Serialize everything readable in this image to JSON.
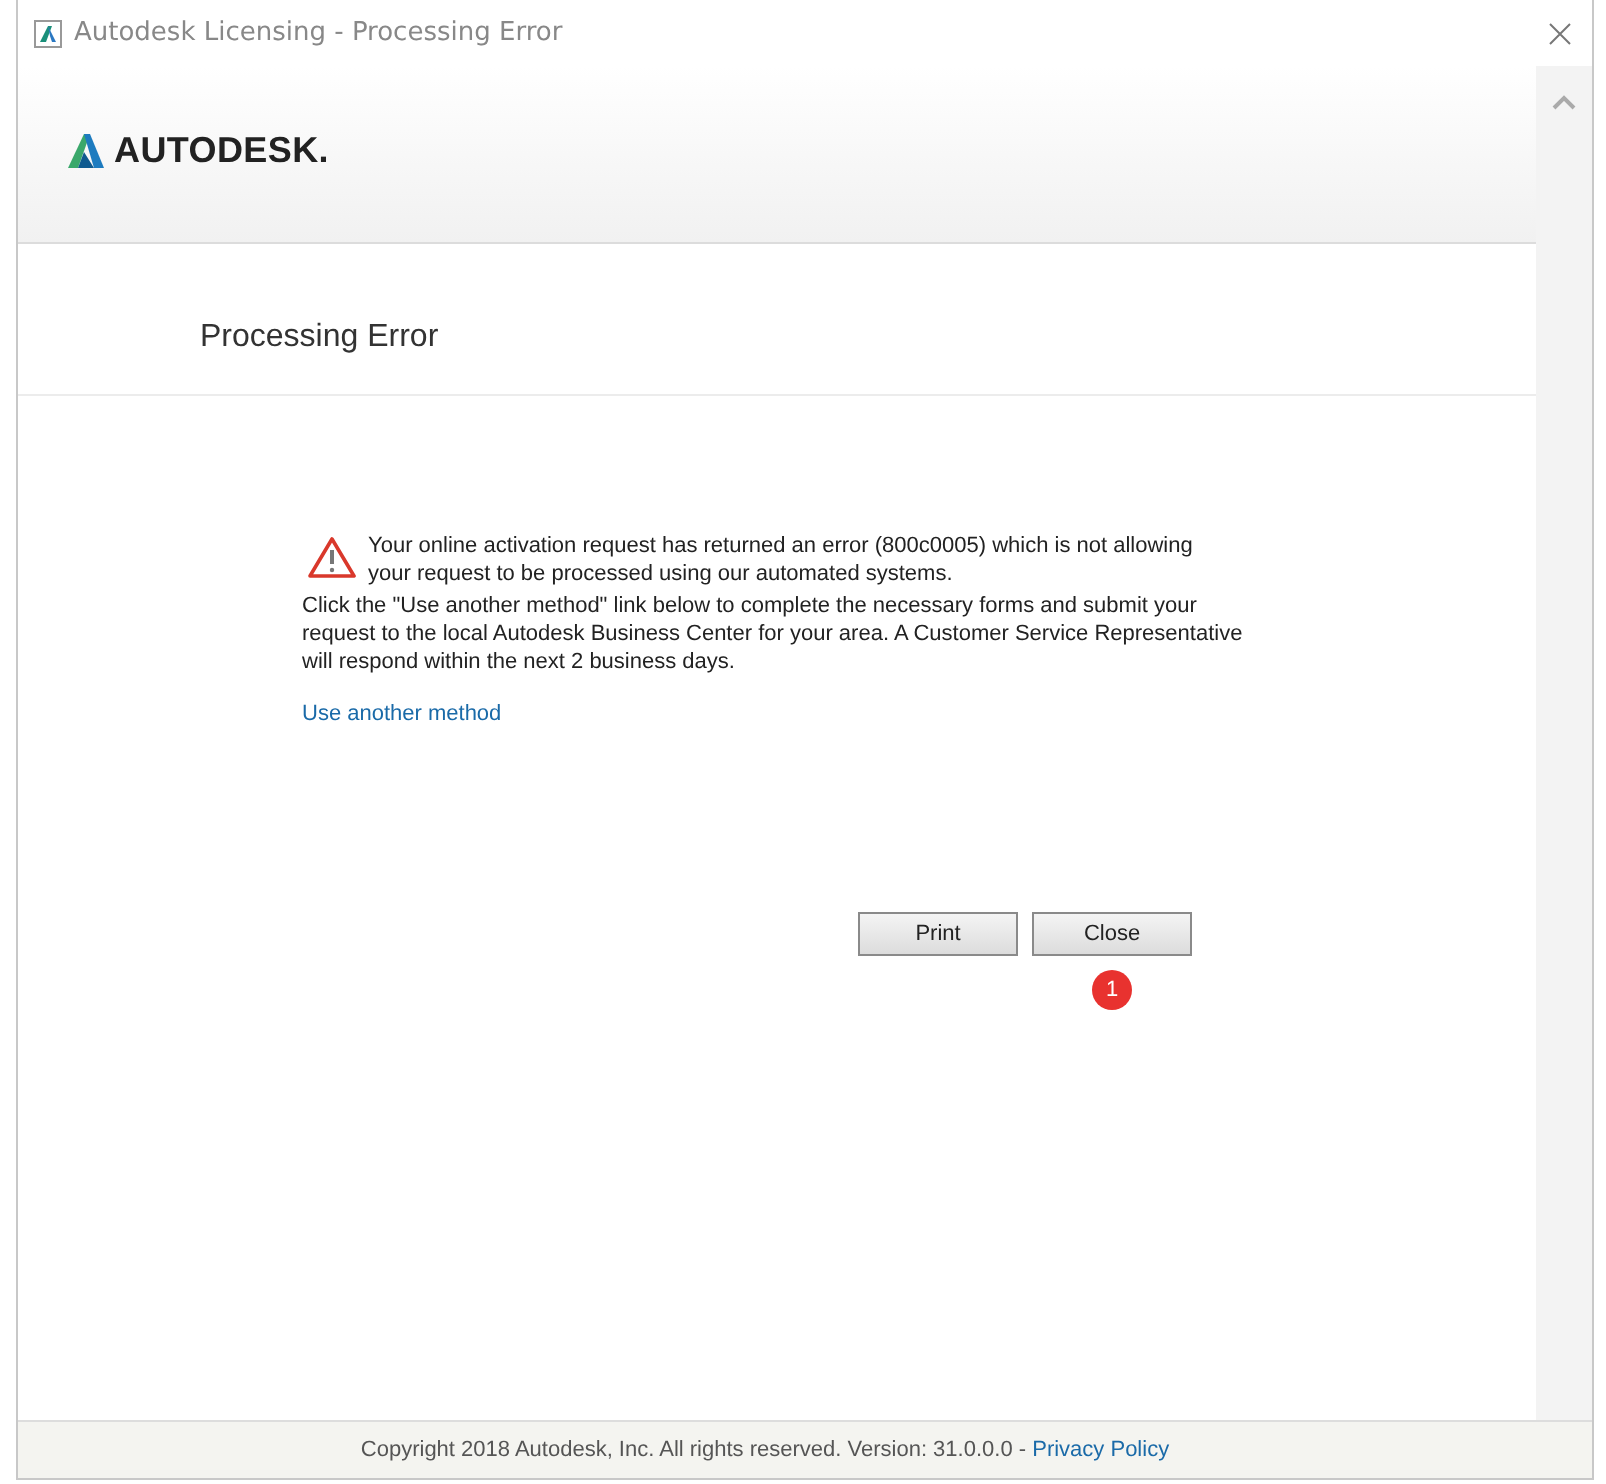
{
  "window": {
    "title": "Autodesk Licensing - Processing Error"
  },
  "header": {
    "brand": "AUTODESK."
  },
  "page_title": "Processing Error",
  "error": {
    "message": "Your online activation request has returned an error (800c0005) which is not allowing your request to be processed using our automated systems.",
    "instructions": "Click the \"Use another method\" link below to complete the necessary forms and submit your request to the local Autodesk Business Center for your area. A Customer Service Representative will respond within the next 2 business days.",
    "link": "Use another method"
  },
  "buttons": [
    {
      "label": "Print"
    },
    {
      "label": "Close",
      "badge": "1"
    }
  ],
  "footer": {
    "text": "Copyright 2018 Autodesk, Inc. All rights reserved. Version: 31.0.0.0 - ",
    "link": "Privacy Policy"
  }
}
